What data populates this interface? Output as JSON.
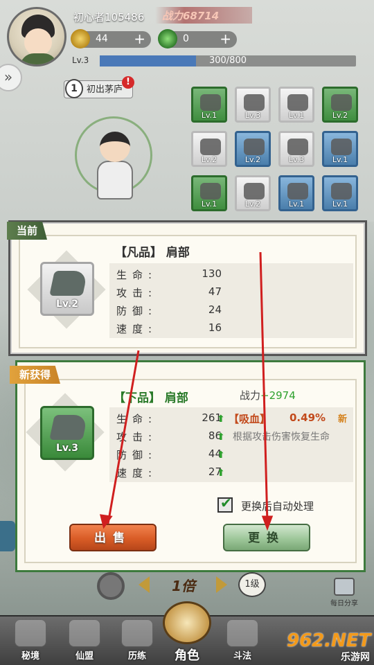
{
  "player": {
    "name": "初心者105486",
    "power_label": "战力68714",
    "resource_1": "44",
    "resource_2": "0",
    "level": "Lv.3",
    "xp_text": "300/800",
    "xp_fraction": 0.375
  },
  "stage": {
    "number": "1",
    "name": "初出茅庐",
    "alert": "!"
  },
  "equipment_slots": [
    {
      "level": "Lv.1",
      "quality": "green"
    },
    {
      "level": "Lv.3",
      "quality": "white"
    },
    {
      "level": "Lv.1",
      "quality": "white"
    },
    {
      "level": "Lv.2",
      "quality": "green"
    },
    {
      "level": "Lv.2",
      "quality": "white"
    },
    {
      "level": "Lv.2",
      "quality": "blue"
    },
    {
      "level": "Lv.3",
      "quality": "white"
    },
    {
      "level": "Lv.1",
      "quality": "blue"
    },
    {
      "level": "Lv.1",
      "quality": "green"
    },
    {
      "level": "Lv.2",
      "quality": "white"
    },
    {
      "level": "Lv.1",
      "quality": "blue"
    },
    {
      "level": "Lv.1",
      "quality": "blue"
    }
  ],
  "current": {
    "tag": "当前",
    "name": "【凡品】 肩部",
    "level": "Lv.2",
    "stats": [
      {
        "key": "生命:",
        "value": "130"
      },
      {
        "key": "攻击:",
        "value": "47"
      },
      {
        "key": "防御:",
        "value": "24"
      },
      {
        "key": "速度:",
        "value": "16"
      }
    ]
  },
  "new_item": {
    "tag": "新获得",
    "name": "【下品】 肩部",
    "level": "Lv.3",
    "power_label": "战力",
    "power_delta": "+2974",
    "stats": [
      {
        "key": "生命:",
        "value": "261"
      },
      {
        "key": "攻击:",
        "value": "86"
      },
      {
        "key": "防御:",
        "value": "44"
      },
      {
        "key": "速度:",
        "value": "27"
      }
    ],
    "special_name": "【吸血】",
    "special_value": "0.49%",
    "special_badge": "新",
    "special_desc": "根据攻击伤害恢复生命",
    "auto_label": "更换后自动处理",
    "auto_checked": true
  },
  "buttons": {
    "sell": "出售",
    "swap": "更换"
  },
  "bottom": {
    "speed": "1倍",
    "level_bubble": "1级",
    "share": "每日分享"
  },
  "tabs": [
    {
      "label": "秘境"
    },
    {
      "label": "仙盟"
    },
    {
      "label": "历练"
    },
    {
      "label": "角色"
    },
    {
      "label": "斗法"
    }
  ],
  "watermark": {
    "line1": "962.NET",
    "line2": "乐游网"
  },
  "colors": {
    "sell_button": "#d95c26",
    "swap_button": "#9ec79a",
    "stat_up": "#2ea12e",
    "special": "#c24a1c",
    "annotation_arrow": "#d01f1f"
  }
}
